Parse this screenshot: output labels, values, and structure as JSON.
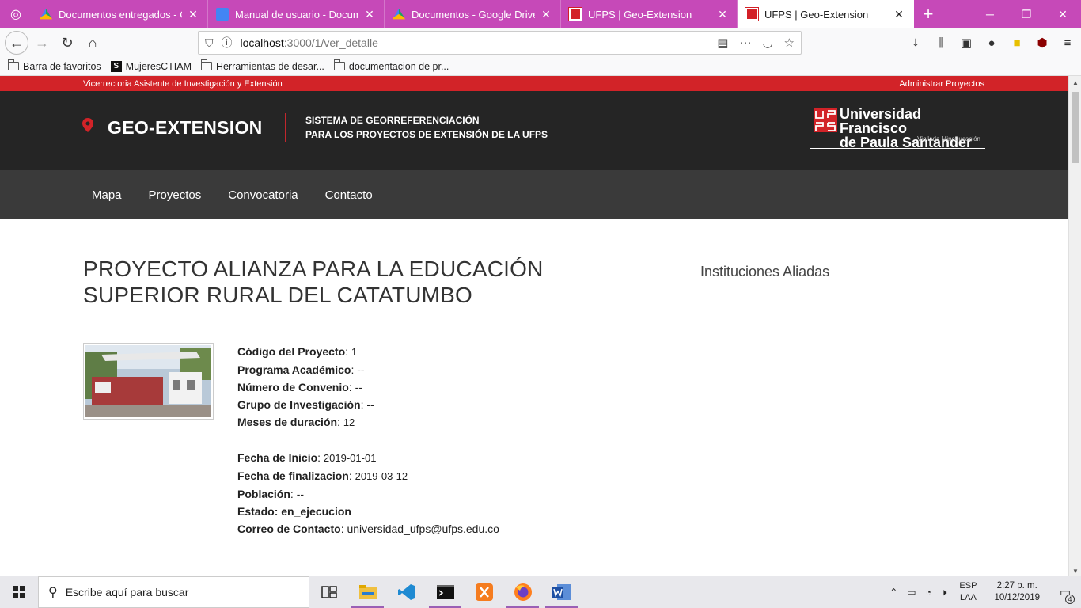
{
  "browser": {
    "tabs": [
      {
        "title": "Documentos entregados - Goo",
        "favicon": "drive-icon",
        "active": false
      },
      {
        "title": "Manual de usuario - Document",
        "favicon": "docs-icon",
        "active": false
      },
      {
        "title": "Documentos - Google Drive",
        "favicon": "drive-icon",
        "active": false
      },
      {
        "title": "UFPS | Geo-Extension",
        "favicon": "ufps-icon",
        "active": false
      },
      {
        "title": "UFPS | Geo-Extension",
        "favicon": "ufps-icon",
        "active": true
      }
    ],
    "url_host": "localhost",
    "url_path": ":3000/1/ver_detalle",
    "bookmarks": [
      {
        "label": "Barra de favoritos",
        "icon": "folder-icon"
      },
      {
        "label": "MujeresCTIAM",
        "icon": "s-icon"
      },
      {
        "label": "Herramientas de desar...",
        "icon": "folder-icon"
      },
      {
        "label": "documentacion de pr...",
        "icon": "folder-icon"
      }
    ]
  },
  "site": {
    "top_left": "Vicerrectoria Asistente de Investigación y Extensión",
    "top_right": "Administrar Proyectos",
    "brand": "GEO-EXTENSION",
    "tagline_1": "SISTEMA DE GEORREFERENCIACIÓN",
    "tagline_2": "PARA LOS PROYECTOS DE EXTENSIÓN DE LA UFPS",
    "uni_line_1": "Universidad Francisco",
    "uni_line_2": "de Paula Santander",
    "uni_sub": "Vigilada Mineducación",
    "accent_color": "#d22328",
    "nav": [
      "Mapa",
      "Proyectos",
      "Convocatoria",
      "Contacto"
    ]
  },
  "project": {
    "title": "PROYECTO ALIANZA PARA LA EDUCACIÓN SUPERIOR RURAL DEL CATATUMBO",
    "sidebar_title": "Instituciones Aliadas",
    "fields": [
      {
        "label": "Código del Proyecto",
        "value": "1"
      },
      {
        "label": "Programa Académico",
        "value": "--"
      },
      {
        "label": "Número de Convenio",
        "value": "--"
      },
      {
        "label": "Grupo de Investigación",
        "value": "--"
      },
      {
        "label": "Meses de duración",
        "value": "12"
      }
    ],
    "fields2": [
      {
        "label": "Fecha de Inicio",
        "value": "2019-01-01"
      },
      {
        "label": "Fecha de finalizacion",
        "value": "2019-03-12"
      },
      {
        "label": "Población",
        "value": "--"
      },
      {
        "label": "Estado",
        "value": "en_ejecucion"
      },
      {
        "label": "Correo de Contacto",
        "value": "universidad_ufps@ufps.edu.co"
      }
    ]
  },
  "taskbar": {
    "search_placeholder": "Escribe aquí para buscar",
    "lang_1": "ESP",
    "lang_2": "LAA",
    "time": "2:27 p. m.",
    "date": "10/12/2019",
    "notifications": "4"
  }
}
